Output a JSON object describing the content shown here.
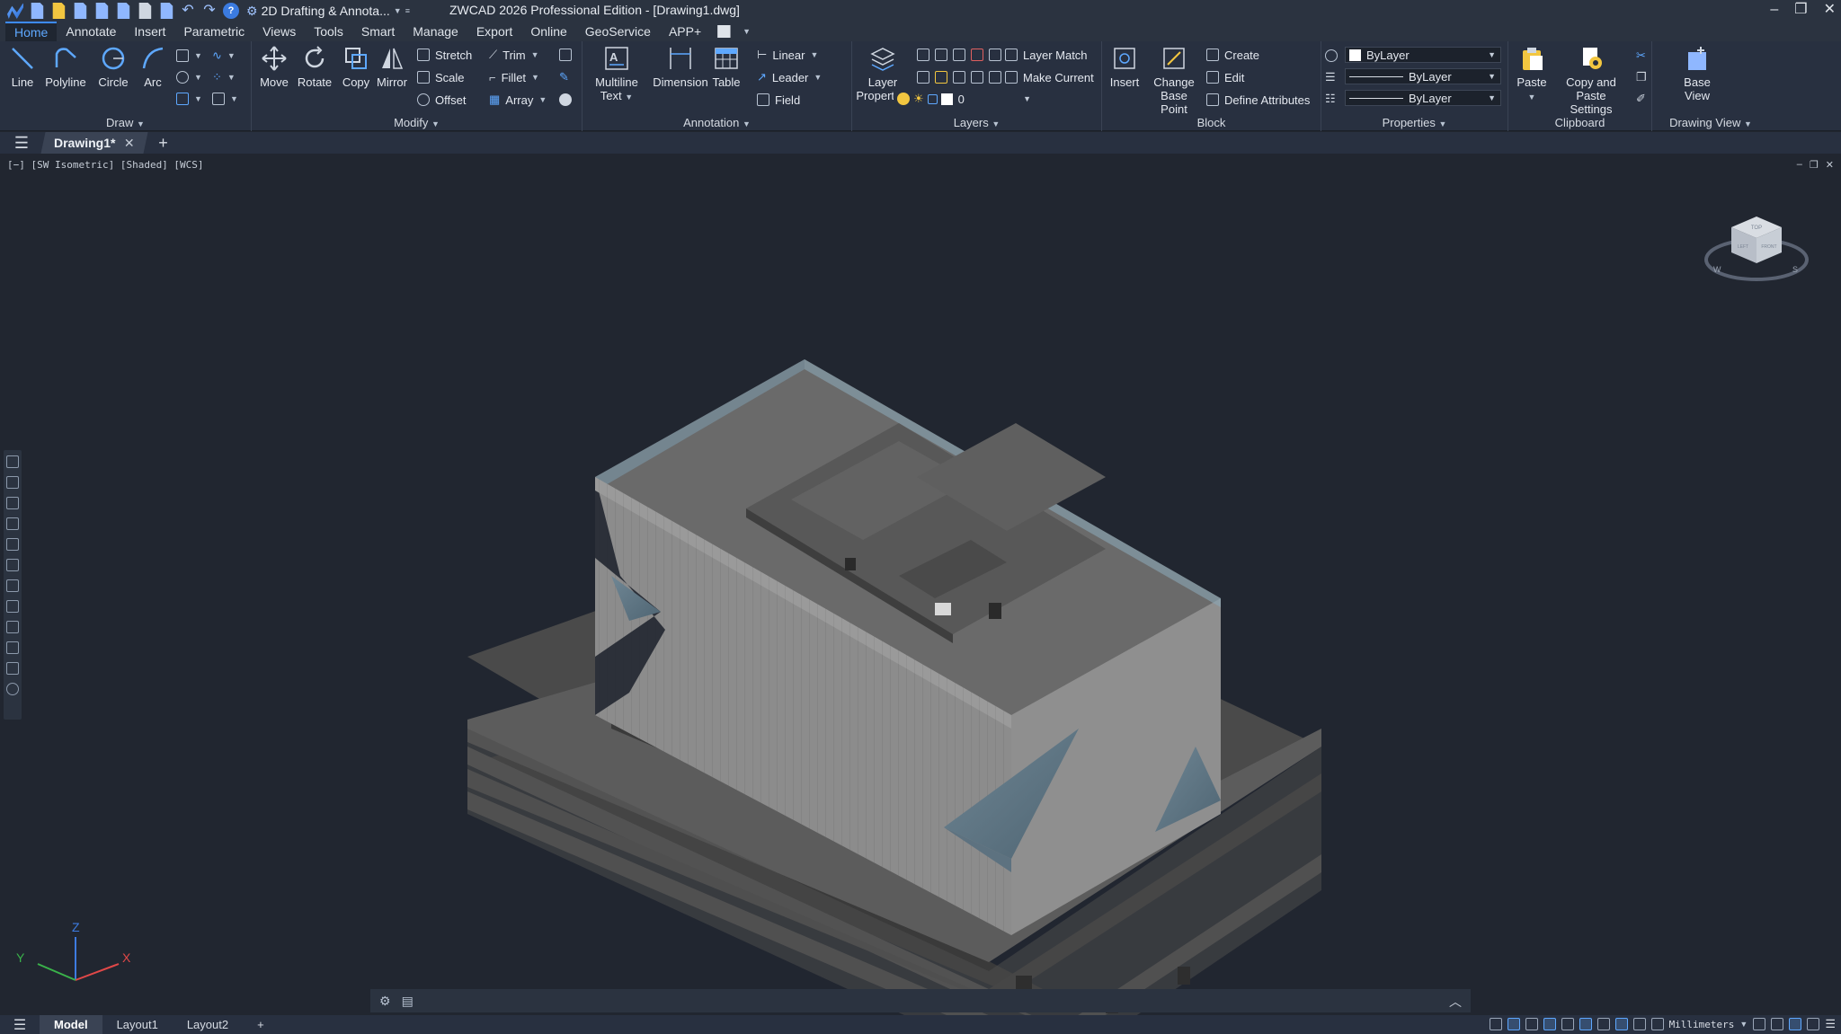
{
  "titlebar": {
    "workspace": "2D Drafting & Annota...",
    "title": "ZWCAD 2026 Professional Edition - [Drawing1.dwg]"
  },
  "menu": {
    "tabs": [
      "Home",
      "Annotate",
      "Insert",
      "Parametric",
      "Views",
      "Tools",
      "Smart",
      "Manage",
      "Export",
      "Online",
      "GeoService",
      "APP+"
    ]
  },
  "ribbon": {
    "draw": {
      "title": "Draw",
      "line": "Line",
      "polyline": "Polyline",
      "circle": "Circle",
      "arc": "Arc"
    },
    "modify": {
      "title": "Modify",
      "move": "Move",
      "rotate": "Rotate",
      "copy": "Copy",
      "mirror": "Mirror",
      "stretch": "Stretch",
      "scale": "Scale",
      "offset": "Offset",
      "trim": "Trim",
      "fillet": "Fillet",
      "array": "Array"
    },
    "annotation": {
      "title": "Annotation",
      "mtext_1": "Multiline",
      "mtext_2": "Text",
      "dimension": "Dimension",
      "table": "Table",
      "linear": "Linear",
      "leader": "Leader",
      "field": "Field"
    },
    "layers": {
      "title": "Layers",
      "props_1": "Layer",
      "props_2": "Properties",
      "match": "Layer Match",
      "make_current": "Make Current",
      "current_layer": "0"
    },
    "block": {
      "title": "Block",
      "insert": "Insert",
      "cbp_1": "Change",
      "cbp_2": "Base Point",
      "create": "Create",
      "edit": "Edit",
      "define": "Define Attributes"
    },
    "properties": {
      "title": "Properties",
      "color": "ByLayer",
      "linetype": "ByLayer",
      "lineweight": "ByLayer"
    },
    "clipboard": {
      "title": "Clipboard",
      "paste": "Paste",
      "cps_1": "Copy and Paste",
      "cps_2": "Settings"
    },
    "drawing_view": {
      "title": "Drawing View",
      "base_1": "Base",
      "base_2": "View"
    }
  },
  "doc": {
    "tab": "Drawing1*"
  },
  "viewport": {
    "label": "[−] [SW Isometric] [Shaded] [WCS]"
  },
  "ucs": {
    "x": "X",
    "y": "Y",
    "z": "Z"
  },
  "viewcube": {
    "top": "TOP",
    "front": "FRONT",
    "left": "LEFT",
    "w": "W",
    "s": "S"
  },
  "status": {
    "layouts": [
      "Model",
      "Layout1",
      "Layout2"
    ],
    "units": "Millimeters"
  }
}
